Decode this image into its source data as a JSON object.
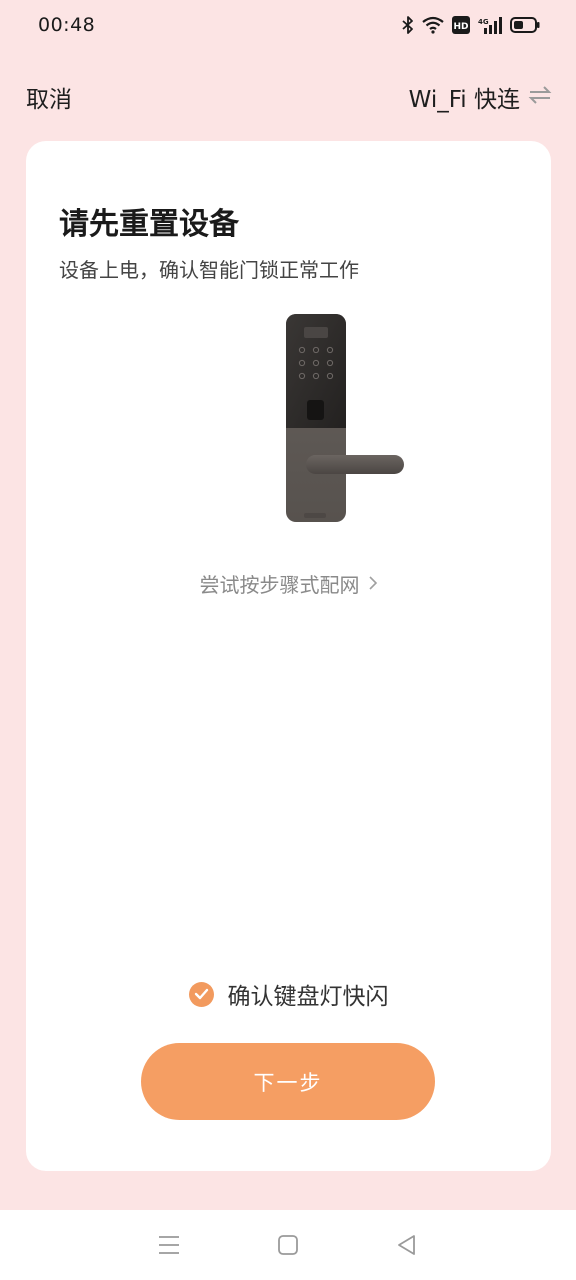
{
  "status_bar": {
    "time": "00:48",
    "icons": [
      "bluetooth-icon",
      "wifi-icon",
      "hd-icon",
      "4g-signal-icon",
      "battery-icon"
    ],
    "hd_label": "HD",
    "network_label": "4G"
  },
  "header": {
    "cancel_label": "取消",
    "wifi_quick_label": "Wi_Fi 快连",
    "switch_icon": "swap-arrows-icon"
  },
  "card": {
    "title": "请先重置设备",
    "subtitle": "设备上电，确认智能门锁正常工作",
    "illustration": "smart-door-lock",
    "step_link_label": "尝试按步骤式配网",
    "confirm_label": "确认键盘灯快闪",
    "confirm_checked": true,
    "next_label": "下一步"
  },
  "system_nav": {
    "items": [
      "menu-icon",
      "home-icon",
      "back-icon"
    ]
  },
  "colors": {
    "background": "#fce4e4",
    "accent": "#f59e63",
    "card": "#ffffff"
  }
}
